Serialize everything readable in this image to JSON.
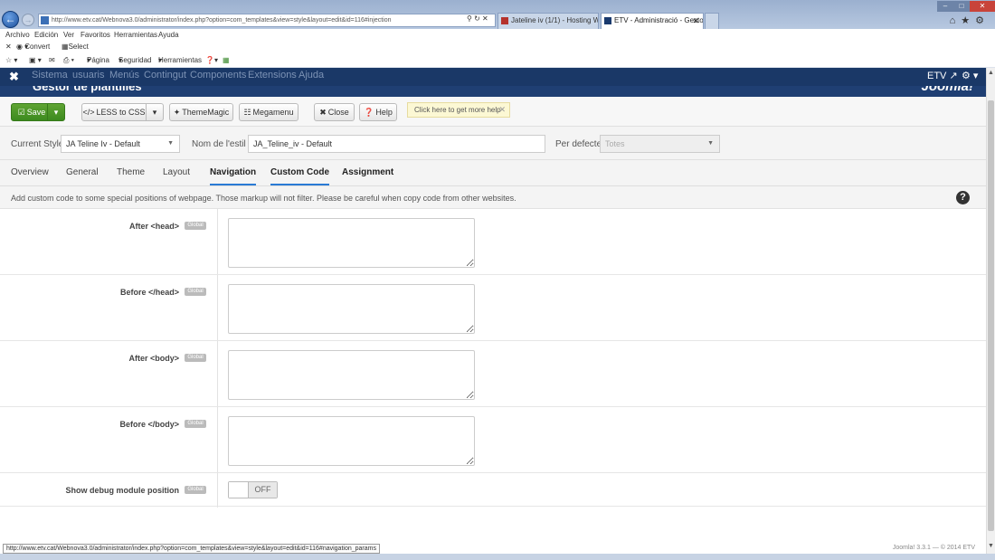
{
  "browser": {
    "address": "http://www.etv.cat/Webnova3.0/administrator/index.php?option=com_templates&view=style&layout=edit&id=116#injection",
    "tabs": [
      {
        "label": "Jateline iv (1/1) - Hosting Wor..."
      },
      {
        "label": "ETV - Administració - Gesto..."
      }
    ],
    "menu": [
      "Archivo",
      "Edición",
      "Ver",
      "Favoritos",
      "Herramientas",
      "Ayuda"
    ],
    "favbar": {
      "convert": "Convert",
      "select": "Select"
    },
    "command": {
      "page": "Página",
      "security": "Seguridad",
      "tools": "Herramientas"
    },
    "status_url": "http://www.etv.cat/Webnova3.0/administrator/index.php?option=com_templates&view=style&layout=edit&id=116#navigation_params",
    "footer": "Joomla! 3.3.1 — © 2014 ETV"
  },
  "admin_nav": {
    "items": [
      "Sistema",
      "usuaris",
      "Menús",
      "Contingut",
      "Components",
      "Extensions",
      "Ajuda"
    ],
    "user": "ETV",
    "header_title": "Gestor de plantilles",
    "brand": "Joomla!"
  },
  "toolbar": {
    "save": "Save",
    "less": "LESS to CSS",
    "thememagic": "ThemeMagic",
    "megamenu": "Megamenu",
    "close": "Close",
    "help": "Help",
    "tip": "Click here to get more help"
  },
  "style": {
    "current_label": "Current Style",
    "current_value": "JA Teline Iv - Default",
    "name_label": "Nom de l'estil *",
    "name_value": "JA_Teline_iv - Default",
    "default_label": "Per defecte",
    "default_value": "Totes"
  },
  "tabs": [
    "Overview",
    "General",
    "Theme",
    "Layout",
    "Navigation",
    "Custom Code",
    "Assignment"
  ],
  "info": "Add custom code to some special positions of webpage. Those markup will not filter. Please be careful when copy code from other websites.",
  "fields": [
    {
      "label": "After <head>",
      "badge": "Global",
      "value": ""
    },
    {
      "label": "Before </head>",
      "badge": "Global",
      "value": ""
    },
    {
      "label": "After <body>",
      "badge": "Global",
      "value": ""
    },
    {
      "label": "Before </body>",
      "badge": "Global",
      "value": ""
    }
  ],
  "debug": {
    "label": "Show debug module position",
    "badge": "Global",
    "state": "OFF"
  }
}
